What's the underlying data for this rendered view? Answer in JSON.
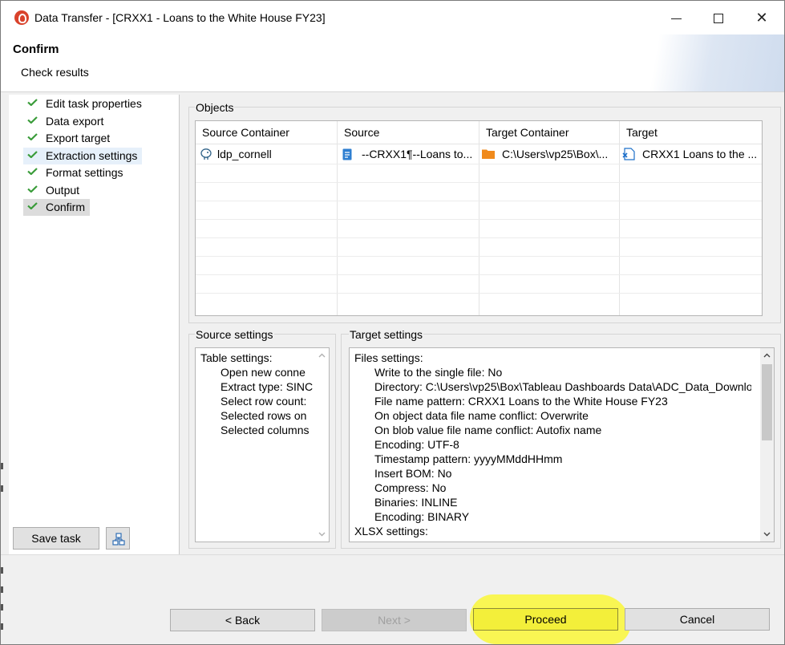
{
  "window": {
    "title": "Data Transfer - [CRXX1 - Loans to the White House FY23]",
    "minimize_icon": "minimize-icon",
    "maximize_icon": "maximize-icon",
    "close_icon": "close-icon",
    "close_glyph": "✕"
  },
  "header": {
    "title": "Confirm",
    "subtitle": "Check results"
  },
  "nav": {
    "items": [
      {
        "label": "Edit task properties"
      },
      {
        "label": "Data export"
      },
      {
        "label": "Export target"
      },
      {
        "label": "Extraction settings"
      },
      {
        "label": "Format settings"
      },
      {
        "label": "Output"
      },
      {
        "label": "Confirm"
      }
    ],
    "check_color": "#3a9c3a"
  },
  "objects": {
    "title": "Objects",
    "columns": [
      "Source Container",
      "Source",
      "Target Container",
      "Target"
    ],
    "row": {
      "source_container": "ldp_cornell",
      "source": "--CRXX1¶--Loans to...",
      "target_container": "C:\\Users\\vp25\\Box\\...",
      "target": "CRXX1 Loans to the ..."
    }
  },
  "source_settings": {
    "title": "Source settings",
    "lines": [
      {
        "text": "Table settings:",
        "indent": 0
      },
      {
        "text": "Open new conne",
        "indent": 1
      },
      {
        "text": "Extract type: SINC",
        "indent": 1
      },
      {
        "text": "Select row count:",
        "indent": 1
      },
      {
        "text": "Selected rows on",
        "indent": 1
      },
      {
        "text": "Selected columns",
        "indent": 1
      }
    ]
  },
  "target_settings": {
    "title": "Target settings",
    "lines": [
      {
        "text": "Files settings:",
        "indent": 0
      },
      {
        "text": "Write to the single file: No",
        "indent": 1
      },
      {
        "text": "Directory: C:\\Users\\vp25\\Box\\Tableau Dashboards Data\\ADC_Data_Downlo",
        "indent": 1
      },
      {
        "text": "File name pattern: CRXX1 Loans to the White House FY23",
        "indent": 1
      },
      {
        "text": "On object data file name conflict: Overwrite",
        "indent": 1
      },
      {
        "text": "On blob value file name conflict: Autofix name",
        "indent": 1
      },
      {
        "text": "Encoding: UTF-8",
        "indent": 1
      },
      {
        "text": "Timestamp pattern: yyyyMMddHHmm",
        "indent": 1
      },
      {
        "text": "Insert BOM: No",
        "indent": 1
      },
      {
        "text": "Compress: No",
        "indent": 1
      },
      {
        "text": "Binaries: INLINE",
        "indent": 1
      },
      {
        "text": "Encoding: BINARY",
        "indent": 1
      },
      {
        "text": "XLSX settings:",
        "indent": 0
      }
    ]
  },
  "buttons": {
    "save_task": "Save task",
    "back": "< Back",
    "next": "Next >",
    "proceed": "Proceed",
    "cancel": "Cancel"
  },
  "colors": {
    "highlight": "#f9f54a",
    "source_icon": "#2f7fd1",
    "folder_icon": "#f08a1c"
  }
}
